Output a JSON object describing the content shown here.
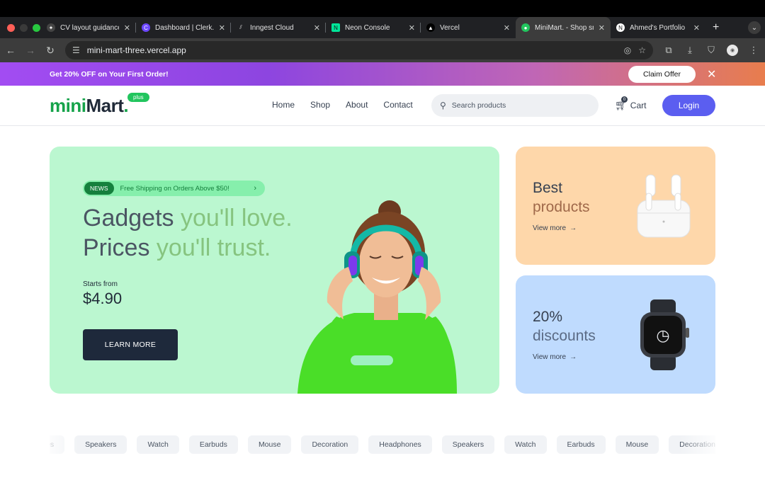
{
  "browser": {
    "tabs": [
      {
        "title": "CV layout guidance",
        "favicon": "openai-icon",
        "active": false
      },
      {
        "title": "Dashboard | Clerk.c",
        "favicon": "clerk-icon",
        "active": false
      },
      {
        "title": "Inngest Cloud",
        "favicon": "inngest-icon",
        "active": false
      },
      {
        "title": "Neon Console",
        "favicon": "neon-icon",
        "active": false
      },
      {
        "title": "Vercel",
        "favicon": "vercel-icon",
        "active": false
      },
      {
        "title": "MiniMart. - Shop sn",
        "favicon": "minimart-icon",
        "active": true
      },
      {
        "title": "Ahmed's Portfolio",
        "favicon": "portfolio-icon",
        "active": false
      }
    ],
    "url": "mini-mart-three.vercel.app"
  },
  "promo": {
    "text": "Get 20% OFF on Your First Order!",
    "cta": "Claim Offer"
  },
  "header": {
    "logo_mini": "mini",
    "logo_mart": "Mart",
    "logo_dot": ".",
    "logo_badge": "plus",
    "nav": [
      "Home",
      "Shop",
      "About",
      "Contact"
    ],
    "search_placeholder": "Search products",
    "cart_label": "Cart",
    "cart_count": "0",
    "login_label": "Login"
  },
  "hero": {
    "news_tag": "NEWS",
    "news_text": "Free Shipping on Orders Above $50!",
    "headline_line1_a": "Gadgets ",
    "headline_line1_b": "you'll love.",
    "headline_line2_a": "Prices ",
    "headline_line2_b": "you'll trust.",
    "starts_from": "Starts from",
    "price": "$4.90",
    "cta": "LEARN MORE"
  },
  "cards": [
    {
      "title_a": "Best",
      "title_b": "products",
      "link": "View more",
      "product": "airpods"
    },
    {
      "title_a": "20%",
      "title_b": "discounts",
      "link": "View more",
      "product": "smartwatch"
    }
  ],
  "categories": [
    "es",
    "Speakers",
    "Watch",
    "Earbuds",
    "Mouse",
    "Decoration",
    "Headphones",
    "Speakers",
    "Watch",
    "Earbuds",
    "Mouse",
    "Decoration"
  ],
  "colors": {
    "brand_green": "#16a34a",
    "login_blue": "#5b5ef0",
    "hero_bg": "#bbf7d0",
    "card_orange": "#fed7aa",
    "card_blue": "#bfdbfe"
  }
}
